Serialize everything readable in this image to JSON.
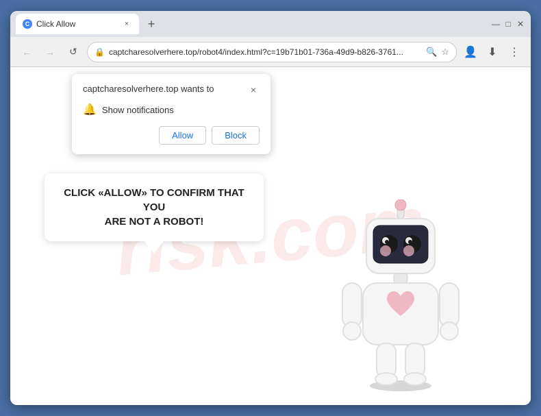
{
  "browser": {
    "tab_title": "Click Allow",
    "tab_favicon": "C",
    "url": "captcharesolverhere.top/robot4/index.html?c=19b71b01-736a-49d9-b826-3761...",
    "new_tab_label": "+",
    "close_tab_label": "×"
  },
  "window_controls": {
    "minimize": "—",
    "maximize": "□",
    "close": "✕"
  },
  "nav": {
    "back": "←",
    "forward": "→",
    "reload": "↺"
  },
  "url_bar": {
    "lock_icon": "🔒",
    "search_icon": "🔍",
    "star_icon": "☆",
    "profile_icon": "👤",
    "menu_icon": "⋮",
    "download_icon": "⬇"
  },
  "notification_popup": {
    "title": "captcharesolverhere.top wants to",
    "close_icon": "×",
    "bell_icon": "🔔",
    "permission_text": "Show notifications",
    "allow_label": "Allow",
    "block_label": "Block"
  },
  "main_message": {
    "line1": "CLICK «ALLOW» TO CONFIRM THAT YOU",
    "line2": "ARE NOT A ROBOT!"
  },
  "watermark": {
    "text": "risk.com"
  }
}
